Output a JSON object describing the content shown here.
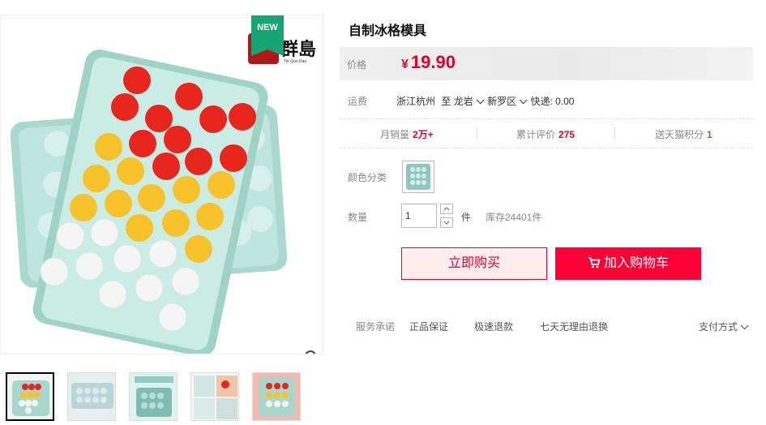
{
  "product": {
    "title": "自制冰格模具",
    "badge": "NEW",
    "brand_text": "群島",
    "brand_sub": "Tie Qun Dao"
  },
  "price": {
    "label": "价格",
    "currency": "¥",
    "value": "19.90"
  },
  "shipping": {
    "label": "运费",
    "from": "浙江杭州",
    "to_word": "至",
    "city": "龙岩",
    "district": "新罗区",
    "express": "快递: 0.00"
  },
  "stats": {
    "monthly_label": "月销量",
    "monthly_value": "2万+",
    "reviews_label": "累计评价",
    "reviews_value": "275",
    "points_label": "送天猫积分",
    "points_value": "1"
  },
  "color": {
    "label": "颜色分类"
  },
  "quantity": {
    "label": "数量",
    "value": "1",
    "unit": "件",
    "stock": "库存24401件"
  },
  "buttons": {
    "buy_now": "立即购买",
    "add_cart": "加入购物车"
  },
  "service": {
    "label": "服务承诺",
    "items": [
      "正品保证",
      "极速退款",
      "七天无理由退换"
    ],
    "payment": "支付方式"
  },
  "colors": {
    "accent": "#e4002b",
    "cart_button": "#ff0036",
    "badge": "#15a574",
    "tray": "#bfe3dc"
  },
  "icons": {
    "zoom": "magnifier-icon",
    "cart": "cart-icon",
    "chevron": "chevron-down-icon"
  }
}
